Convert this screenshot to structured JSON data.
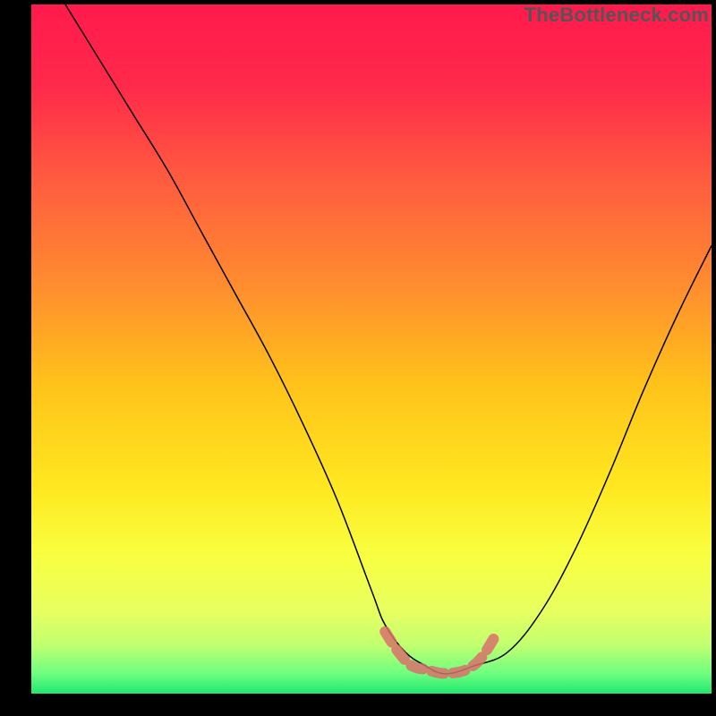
{
  "watermark": "TheBottleneck.com",
  "chart_data": {
    "type": "line",
    "title": "",
    "xlabel": "",
    "ylabel": "",
    "xlim": [
      0,
      100
    ],
    "ylim": [
      0,
      100
    ],
    "legend": false,
    "grid": false,
    "background": {
      "type": "vertical-gradient",
      "stops": [
        {
          "pos": 0.0,
          "color": "#ff1a4d"
        },
        {
          "pos": 0.12,
          "color": "#ff2a4a"
        },
        {
          "pos": 0.25,
          "color": "#ff5a3f"
        },
        {
          "pos": 0.4,
          "color": "#ff8a30"
        },
        {
          "pos": 0.55,
          "color": "#ffc21a"
        },
        {
          "pos": 0.7,
          "color": "#ffe820"
        },
        {
          "pos": 0.8,
          "color": "#f8ff40"
        },
        {
          "pos": 0.88,
          "color": "#e8ff60"
        },
        {
          "pos": 0.93,
          "color": "#c0ff70"
        },
        {
          "pos": 0.97,
          "color": "#70ff80"
        },
        {
          "pos": 1.0,
          "color": "#20e870"
        }
      ]
    },
    "series": [
      {
        "name": "bottleneck-curve",
        "color": "#000000",
        "stroke_width": 1.5,
        "x": [
          5,
          10,
          15,
          20,
          25,
          30,
          35,
          40,
          45,
          50,
          52,
          55,
          58,
          60,
          62,
          65,
          70,
          75,
          80,
          85,
          90,
          95,
          100
        ],
        "y": [
          100,
          92,
          84,
          76,
          67,
          58,
          49,
          39,
          28,
          15,
          10,
          6,
          4,
          3,
          3,
          4,
          6,
          12,
          21,
          32,
          44,
          55,
          65
        ]
      }
    ],
    "highlight": {
      "name": "optimal-zone-marker",
      "color": "#d8716b",
      "stroke_width": 12,
      "opacity": 0.85,
      "x": [
        52,
        54,
        56,
        58,
        60,
        62,
        64,
        66,
        68
      ],
      "y": [
        9,
        6,
        4,
        3.5,
        3,
        3,
        3.5,
        5,
        8
      ]
    }
  }
}
